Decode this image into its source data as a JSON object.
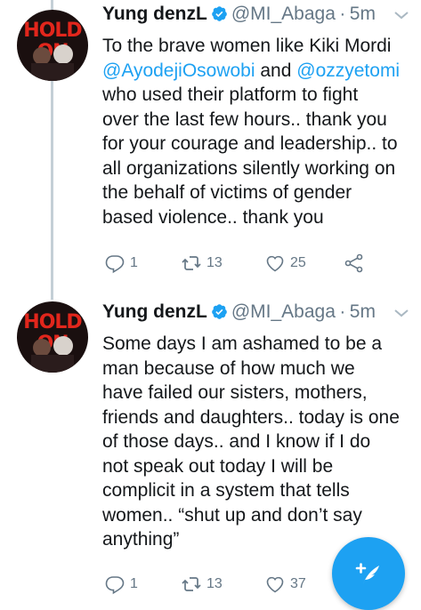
{
  "tweets": [
    {
      "avatar_text": "HOLD ON",
      "display_name": "Yung denzL",
      "handle": "@MI_Abaga",
      "separator": "·",
      "time": "5m",
      "lines": [
        [
          {
            "t": "To the brave women like Kiki Mordi"
          }
        ],
        [
          {
            "t": "@AyodejiOsowobi",
            "m": true
          },
          {
            "t": " and "
          },
          {
            "t": "@ozzyetomi",
            "m": true
          }
        ],
        [
          {
            "t": "who used their platform to fight"
          }
        ],
        [
          {
            "t": "over the last few hours.. thank you"
          }
        ],
        [
          {
            "t": "for your courage and leadership.. to"
          }
        ],
        [
          {
            "t": "all organizations silently working on"
          }
        ],
        [
          {
            "t": "the behalf of victims of gender"
          }
        ],
        [
          {
            "t": "based violence.. thank you"
          }
        ]
      ],
      "replies": "1",
      "retweets": "13",
      "likes": "25"
    },
    {
      "avatar_text": "HOLD ON",
      "display_name": "Yung denzL",
      "handle": "@MI_Abaga",
      "separator": "·",
      "time": "5m",
      "lines": [
        [
          {
            "t": "Some days I am ashamed to be a"
          }
        ],
        [
          {
            "t": "man because of how much we"
          }
        ],
        [
          {
            "t": "have failed our sisters, mothers,"
          }
        ],
        [
          {
            "t": "friends and daughters.. today is one"
          }
        ],
        [
          {
            "t": "of those days.. and I know if I do"
          }
        ],
        [
          {
            "t": "not speak out today I will be"
          }
        ],
        [
          {
            "t": "complicit in a system that tells"
          }
        ],
        [
          {
            "t": "women.. “shut up and don’t say"
          }
        ],
        [
          {
            "t": "anything”"
          }
        ]
      ],
      "replies": "1",
      "retweets": "13",
      "likes": "37"
    }
  ],
  "icons": {
    "reply": "reply-icon",
    "retweet": "retweet-icon",
    "like": "heart-icon",
    "share": "share-icon",
    "compose": "compose-icon",
    "verified": "verified-badge-icon",
    "caret": "chevron-down-icon"
  },
  "colors": {
    "brand": "#1da1f2",
    "text": "#14171a",
    "muted": "#657786",
    "thread": "#c4cfd6"
  }
}
